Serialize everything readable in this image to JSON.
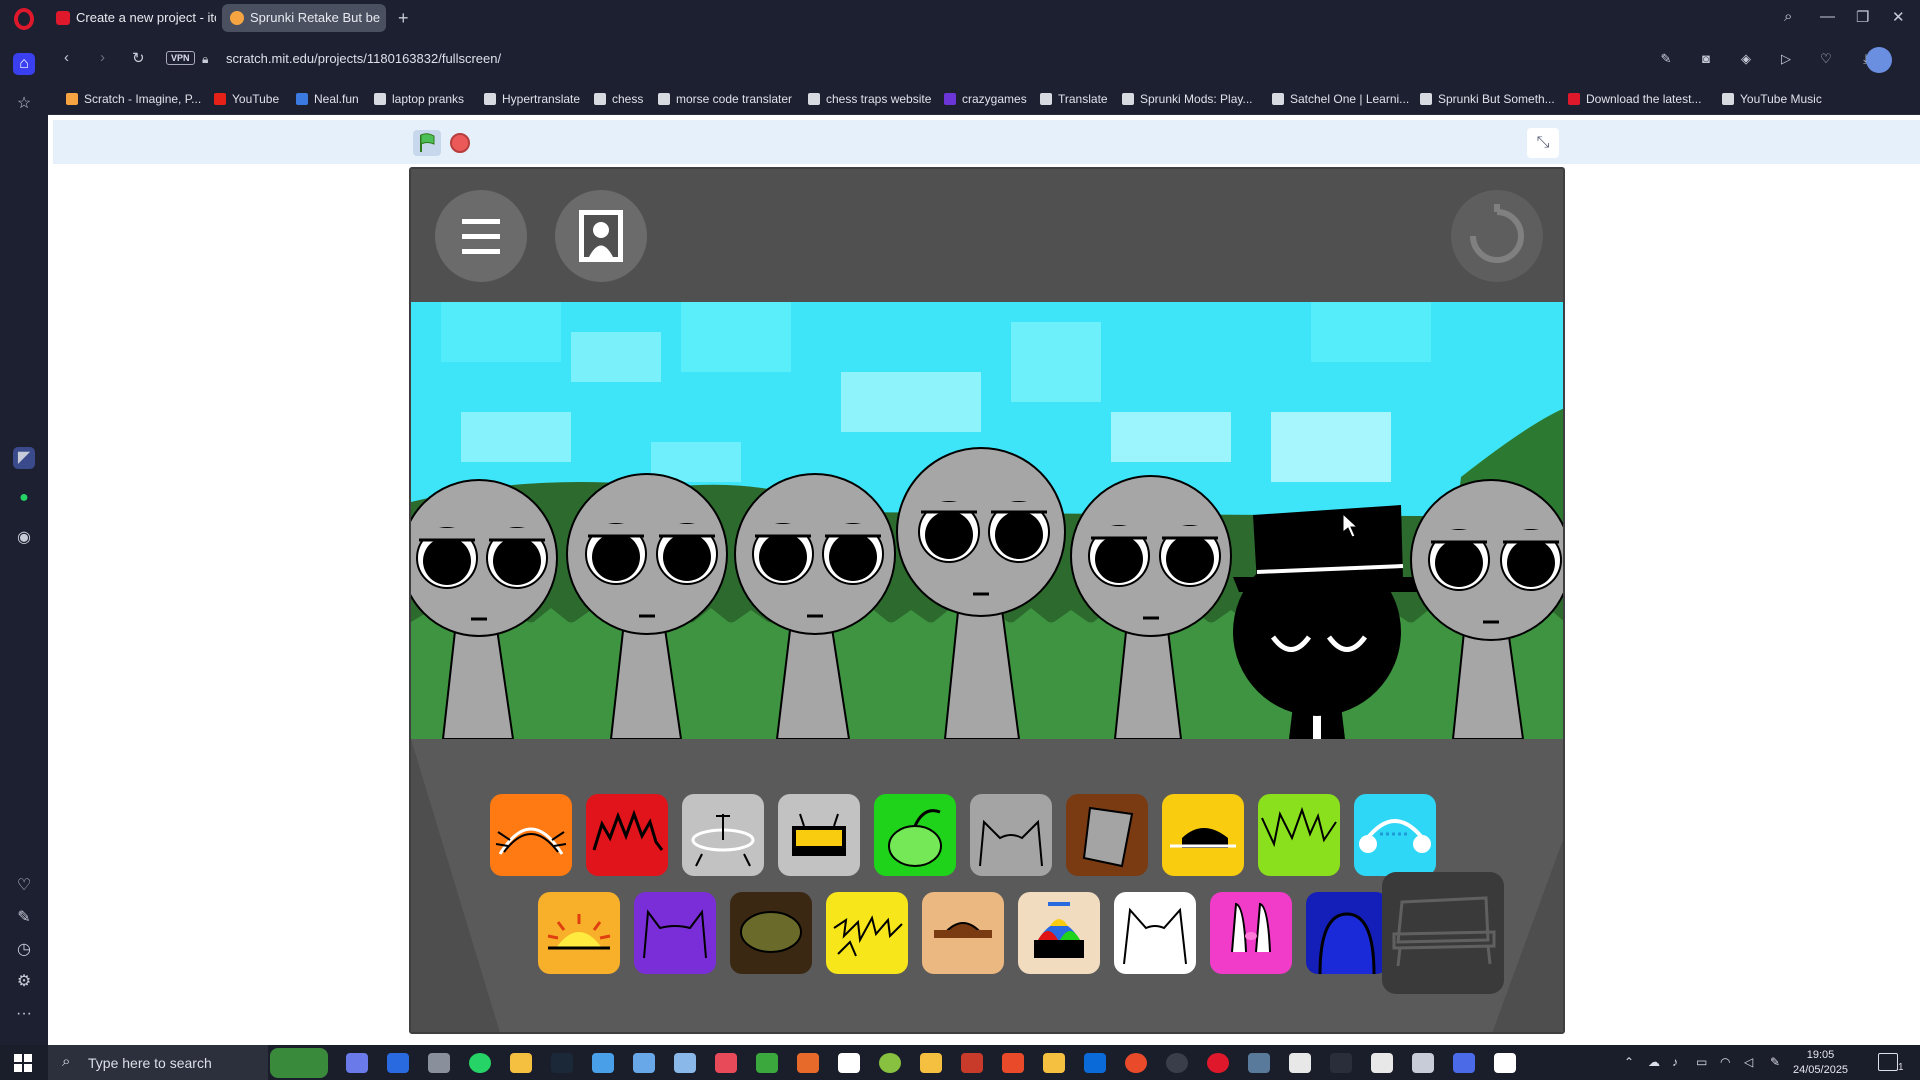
{
  "browser": {
    "tabs": [
      {
        "label": "Create a new project - itch"
      },
      {
        "label": "Sprunki Retake But be"
      }
    ],
    "url": "scratch.mit.edu/projects/1180163832/fullscreen/",
    "vpn_label": "VPN",
    "bookmarks": [
      {
        "label": "Scratch - Imagine, P..."
      },
      {
        "label": "YouTube"
      },
      {
        "label": "Neal.fun"
      },
      {
        "label": "laptop pranks"
      },
      {
        "label": "Hypertranslate"
      },
      {
        "label": "chess"
      },
      {
        "label": "morse code translater"
      },
      {
        "label": "chess traps website"
      },
      {
        "label": "crazygames"
      },
      {
        "label": "Translate"
      },
      {
        "label": "Sprunki Mods: Play..."
      },
      {
        "label": "Satchel One | Learni..."
      },
      {
        "label": "Sprunki But Someth..."
      },
      {
        "label": "Download the latest..."
      },
      {
        "label": "YouTube Music"
      }
    ]
  },
  "game": {
    "palette_row1": [
      "orange",
      "red",
      "silver",
      "gray-box",
      "green",
      "gray-cat",
      "brown",
      "yellow",
      "lime",
      "cyan"
    ],
    "palette_row2": [
      "sun",
      "purple",
      "dark-green",
      "yellow-spiky",
      "tan-hat",
      "propeller",
      "white-cat",
      "pink-bunny",
      "navy",
      "empty-slot"
    ],
    "colors": {
      "orange": "#ff7a12",
      "red": "#e0141a",
      "silver": "#c2c2c2",
      "gray": "#a4a4a4",
      "green": "#1fd21a",
      "brown": "#7a3a12",
      "yellow": "#f9cc10",
      "lime": "#8ae01c",
      "cyan": "#2ed7f6",
      "sun": "#f8b02a",
      "purple": "#7a2ed8",
      "dark": "#3a2812",
      "tan": "#ecb882",
      "navy": "#141eb8"
    }
  },
  "taskbar": {
    "search_placeholder": "Type here to search",
    "time": "19:05",
    "date": "24/05/2025",
    "notification_count": "1"
  }
}
